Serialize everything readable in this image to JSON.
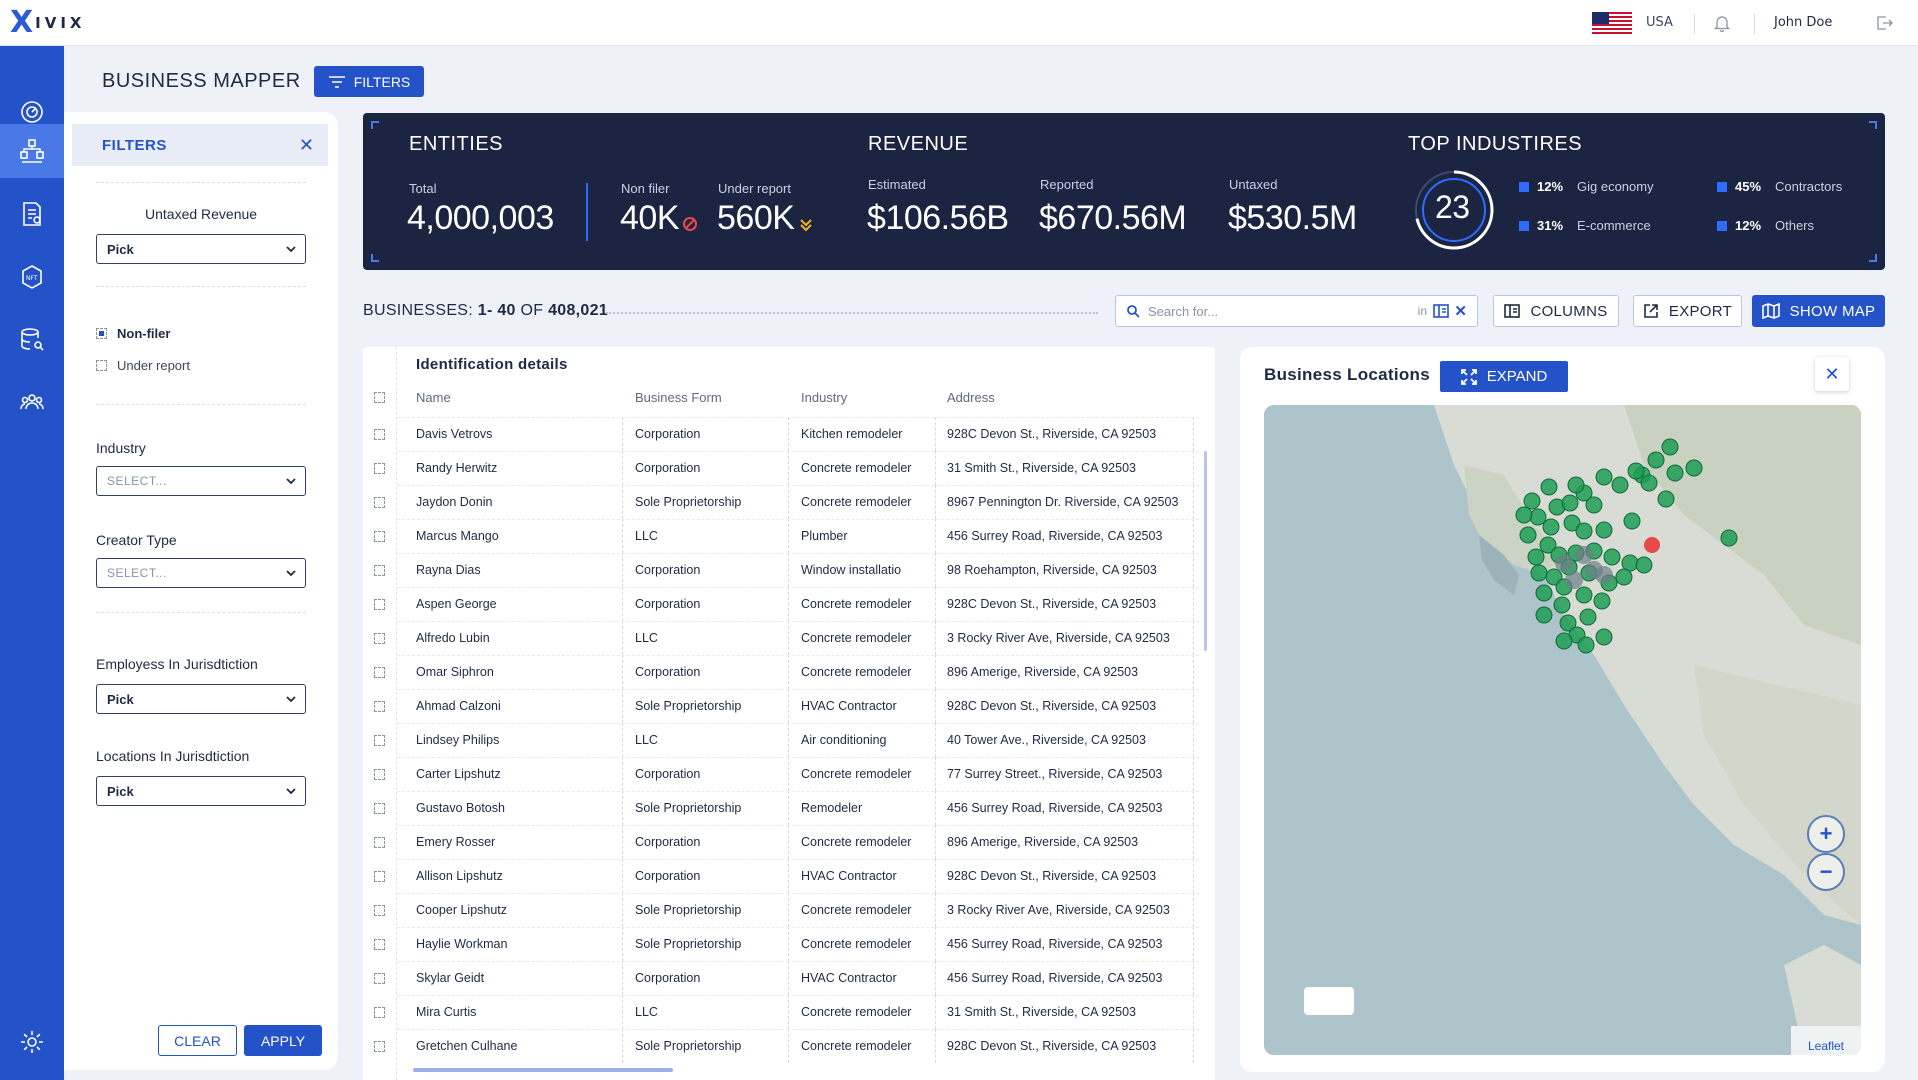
{
  "brand": {
    "logo_mark": "X",
    "logo_text": "IVIX"
  },
  "topbar": {
    "country": "USA",
    "user": "John Doe",
    "icons": [
      "us-flag-icon",
      "bell-icon",
      "logout-icon"
    ]
  },
  "nav": {
    "items": [
      "dashboard-icon",
      "business-mapper-icon",
      "reports-icon",
      "nft-icon",
      "database-search-icon",
      "people-icon",
      "settings-icon"
    ],
    "active": "business-mapper-icon"
  },
  "page": {
    "title": "BUSINESS MAPPER",
    "filters_button": "FILTERS"
  },
  "filters": {
    "title": "FILTERS",
    "untaxed_revenue": {
      "label": "Untaxed Revenue",
      "value": "Pick"
    },
    "checks": [
      {
        "label": "Non-filer",
        "checked": true
      },
      {
        "label": "Under report",
        "checked": false
      }
    ],
    "industry": {
      "label": "Industry",
      "placeholder": "SELECT..."
    },
    "creator_type": {
      "label": "Creator Type",
      "placeholder": "SELECT..."
    },
    "employees": {
      "label": "Employess In Jurisdtiction",
      "value": "Pick"
    },
    "locations": {
      "label": "Locations In Jurisdtiction",
      "value": "Pick"
    },
    "clear": "CLEAR",
    "apply": "APPLY"
  },
  "stats": {
    "entities": {
      "title": "ENTITIES",
      "total_label": "Total",
      "total": "4,000,003",
      "nonfiler_label": "Non filer",
      "nonfiler": "40K",
      "under_label": "Under report",
      "under": "560K"
    },
    "revenue": {
      "title": "REVENUE",
      "estimated_label": "Estimated",
      "estimated": "$106.56B",
      "reported_label": "Reported",
      "reported": "$670.56M",
      "untaxed_label": "Untaxed",
      "untaxed": "$530.5M"
    },
    "industries": {
      "title": "TOP INDUSTIRES",
      "count": "23",
      "items": [
        {
          "pct": "12%",
          "name": "Gig economy"
        },
        {
          "pct": "45%",
          "name": "Contractors"
        },
        {
          "pct": "31%",
          "name": "E-commerce"
        },
        {
          "pct": "12%",
          "name": "Others"
        }
      ]
    },
    "colors": {
      "panel": "#1b2541",
      "accent": "#2f6bff",
      "nonfiler_icon": "#e84a4a",
      "under_icon": "#f2b21b"
    }
  },
  "toolbar": {
    "businesses_label": "BUSINESSES:",
    "range": "1- 40",
    "of": "OF",
    "total": "408,021",
    "search_placeholder": "Search for...",
    "search_in": "in",
    "columns": "COLUMNS",
    "export": "EXPORT",
    "show_map": "SHOW MAP"
  },
  "table": {
    "section_title": "Identification details",
    "headers": [
      "Name",
      "Business Form",
      "Industry",
      "Address"
    ],
    "rows": [
      [
        "Davis Vetrovs",
        "Corporation",
        "Kitchen remodeler",
        "928C Devon St., Riverside, CA 92503"
      ],
      [
        "Randy Herwitz",
        "Corporation",
        "Concrete remodeler",
        "31 Smith St., Riverside, CA 92503"
      ],
      [
        "Jaydon Donin",
        "Sole Proprietorship",
        "Concrete remodeler",
        "8967 Pennington Dr. Riverside, CA 92503"
      ],
      [
        "Marcus Mango",
        "LLC",
        "Plumber",
        "456 Surrey Road, Riverside, CA 92503"
      ],
      [
        "Rayna Dias",
        "Corporation",
        "Window installatio",
        "98 Roehampton, Riverside, CA 92503"
      ],
      [
        "Aspen George",
        "Corporation",
        "Concrete remodeler",
        "928C Devon St., Riverside, CA 92503"
      ],
      [
        "Alfredo Lubin",
        "LLC",
        "Concrete remodeler",
        "3 Rocky River Ave, Riverside, CA 92503"
      ],
      [
        "Omar Siphron",
        "Corporation",
        "Concrete remodeler",
        "896 Amerige, Riverside, CA 92503"
      ],
      [
        "Ahmad Calzoni",
        "Sole Proprietorship",
        "HVAC Contractor",
        "928C Devon St., Riverside, CA 92503"
      ],
      [
        "Lindsey Philips",
        "LLC",
        "Air conditioning",
        "40 Tower Ave., Riverside, CA 92503"
      ],
      [
        "Carter Lipshutz",
        "Corporation",
        "Concrete remodeler",
        "77 Surrey Street., Riverside, CA 92503"
      ],
      [
        "Gustavo Botosh",
        "Sole Proprietorship",
        "Remodeler",
        "456 Surrey Road, Riverside, CA 92503"
      ],
      [
        "Emery Rosser",
        "Corporation",
        "Concrete remodeler",
        "896 Amerige, Riverside, CA 92503"
      ],
      [
        "Allison Lipshutz",
        "Corporation",
        "HVAC Contractor",
        "928C Devon St., Riverside, CA 92503"
      ],
      [
        "Cooper Lipshutz",
        "Sole Proprietorship",
        "Concrete remodeler",
        "3 Rocky River Ave, Riverside, CA 92503"
      ],
      [
        "Haylie Workman",
        "Sole Proprietorship",
        "Concrete remodeler",
        "456 Surrey Road, Riverside, CA 92503"
      ],
      [
        "Skylar Geidt",
        "Corporation",
        "HVAC Contractor",
        "456 Surrey Road, Riverside, CA 92503"
      ],
      [
        "Mira Curtis",
        "LLC",
        "Concrete remodeler",
        "31 Smith St., Riverside, CA 92503"
      ],
      [
        "Gretchen Culhane",
        "Sole Proprietorship",
        "Concrete remodeler",
        "928C Devon St., Riverside, CA 92503"
      ]
    ]
  },
  "map": {
    "title": "Business Locations",
    "expand": "EXPAND",
    "zoom_in": "+",
    "zoom_out": "−",
    "attribution": "Leaflet",
    "marker_color": "#1f9d55",
    "highlight_color": "#e84a4a"
  }
}
